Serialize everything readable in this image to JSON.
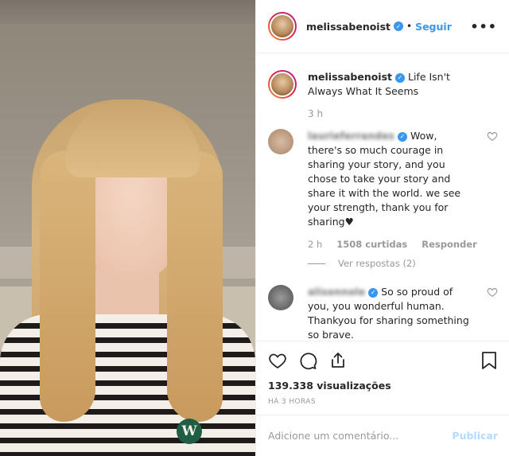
{
  "post": {
    "username": "melissabenoist",
    "follow_label": "Seguir",
    "separator": "•",
    "more_label": "•••",
    "caption_text": "Life Isn't Always What It Seems",
    "caption_time": "3 h",
    "shirt_logo": "W"
  },
  "comments": [
    {
      "username": "laurieferrandes",
      "text": "Wow, there's so much courage in sharing your story, and you chose to take your story and share it with the world. we see your strength, thank you for sharing♥",
      "time": "2 h",
      "likes": "1508 curtidas",
      "reply_label": "Responder",
      "view_replies": "Ver respostas (2)",
      "avatar_color": "#c4a58c"
    },
    {
      "username": "alisonnole",
      "text": "So so proud of you, you wonderful human. Thankyou for sharing something so brave.",
      "emoji": "♥",
      "avatar_color": "#6f6f6f"
    }
  ],
  "actions": {
    "icons": [
      "heart-icon",
      "comment-icon",
      "share-icon",
      "bookmark-icon"
    ],
    "views": "139.338 visualizações",
    "posted_ago": "HÁ 3 HORAS"
  },
  "add_comment": {
    "placeholder": "Adicione um comentário...",
    "publish_label": "Publicar"
  },
  "colors": {
    "link_blue": "#3897f0",
    "publish_disabled": "#b3dbff",
    "muted_text": "#999999"
  }
}
